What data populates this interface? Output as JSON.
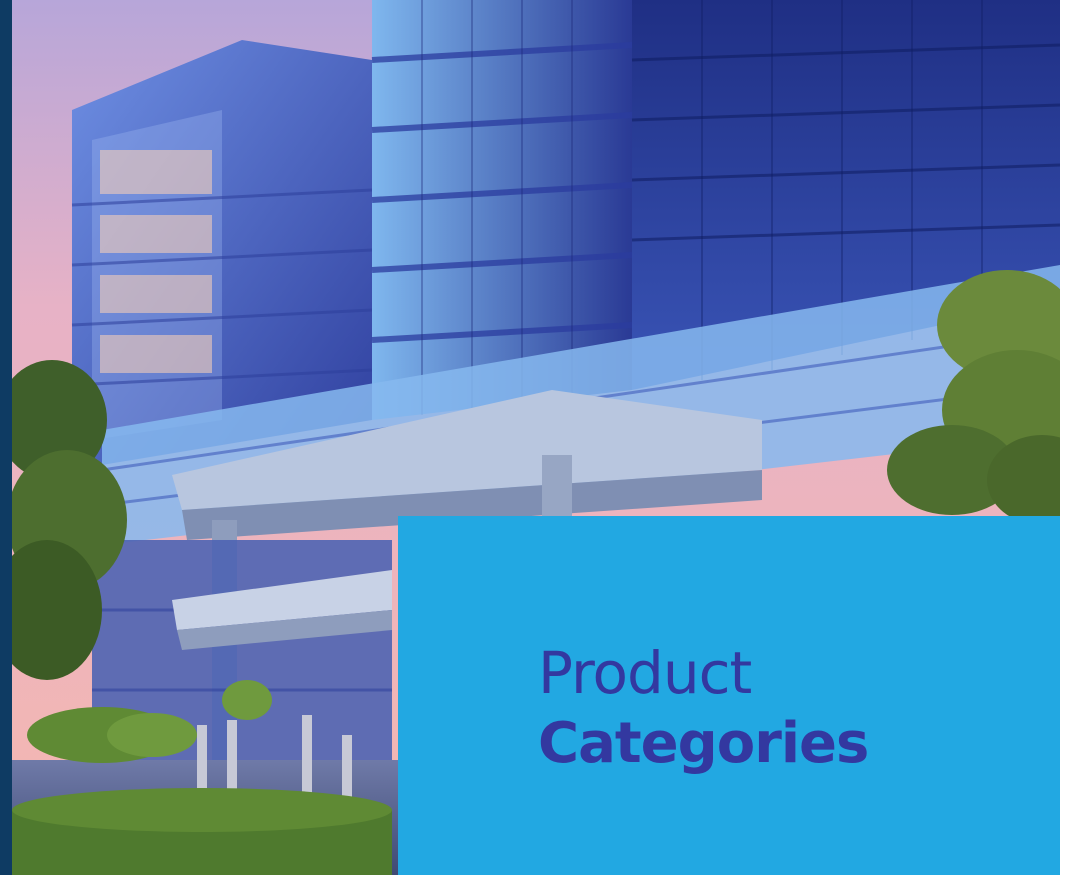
{
  "hero": {
    "image_icon": "office-building-illustration",
    "colors": {
      "sky_top": "#c7a7d8",
      "sky_bottom": "#f2b3b8",
      "glass_dark": "#2d3f9c",
      "glass_light": "#8fc3ee",
      "trees": "#6b8a3c"
    }
  },
  "panel": {
    "color": "#22a8e2",
    "title_line1": "Product",
    "title_line2": "Categories",
    "text_color": "#3338a0"
  },
  "frame": {
    "left_strip_color": "#0e3b63"
  }
}
